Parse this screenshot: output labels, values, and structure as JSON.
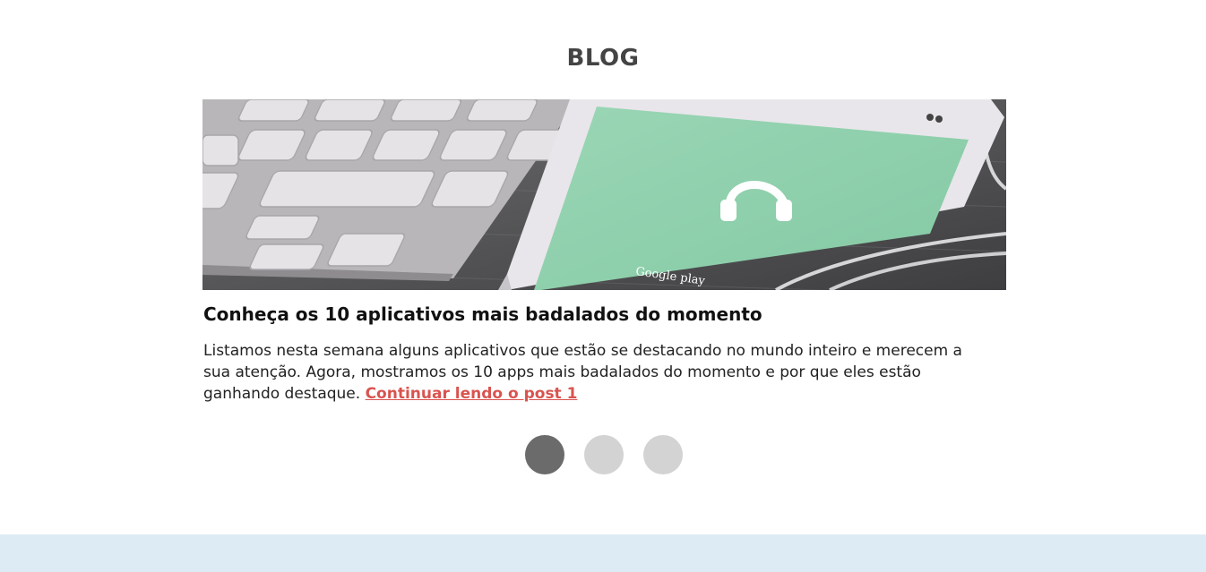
{
  "section": {
    "title": "BLOG"
  },
  "post": {
    "title": "Conheça os 10 aplicativos mais badalados do momento",
    "excerpt": "Listamos nesta semana alguns aplicativos que estão se destacando no mundo inteiro e merecem a sua atenção. Agora, mostramos os 10 apps mais badalados do momento e por que eles estão ganhando destaque.",
    "link_label": "Continuar lendo o post 1",
    "image_text": "Google play",
    "image_icon": "headphones-icon"
  },
  "carousel": {
    "dot_count": 3,
    "active_index": 0
  },
  "colors": {
    "title": "#444444",
    "link": "#d9534f",
    "dot_active": "#6b6b6b",
    "dot_inactive": "#d3d3d3",
    "footer_band": "#ddecf4",
    "phone_screen": "#8fd1ad"
  }
}
